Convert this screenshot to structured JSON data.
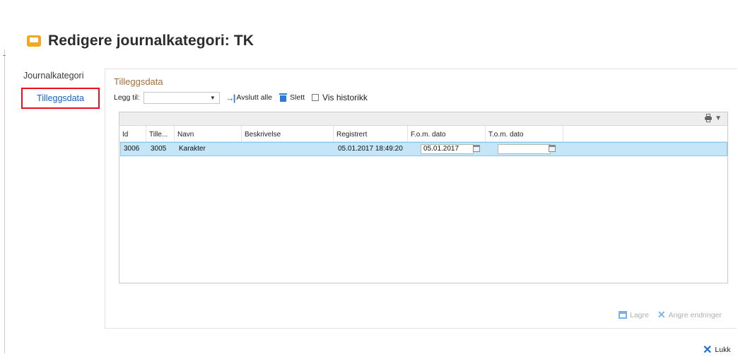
{
  "dialog": {
    "title": "Redigere journalkategori: TK"
  },
  "nav": {
    "items": [
      {
        "label": "Journalkategori",
        "selected": false
      },
      {
        "label": "Tilleggsdata",
        "selected": true
      }
    ]
  },
  "panel": {
    "title": "Tilleggsdata",
    "toolbar": {
      "add_label": "Legg til:",
      "add_select_value": "",
      "end_all_label": "Avslutt alle",
      "delete_label": "Slett",
      "show_history_label": "Vis historikk",
      "show_history_checked": false
    },
    "grid": {
      "columns": [
        "Id",
        "Tille...",
        "Navn",
        "Beskrivelse",
        "Registrert",
        "F.o.m. dato",
        "T.o.m. dato"
      ],
      "rows": [
        {
          "id": "3006",
          "tillegg": "3005",
          "navn": "Karakter",
          "beskrivelse": "",
          "registrert": "05.01.2017 18:49:20",
          "fom": "05.01.2017",
          "tom": "",
          "selected": true
        }
      ]
    },
    "footer": {
      "save_label": "Lagre",
      "undo_label": "Angre endringer"
    }
  },
  "dialog_footer": {
    "close_label": "Lukk"
  },
  "colors": {
    "accent": "#1b62c4",
    "title_icon": "#f6a623",
    "highlight_border": "#e8101a",
    "selected_row": "#c4e6f6",
    "section_title": "#a1703d"
  }
}
